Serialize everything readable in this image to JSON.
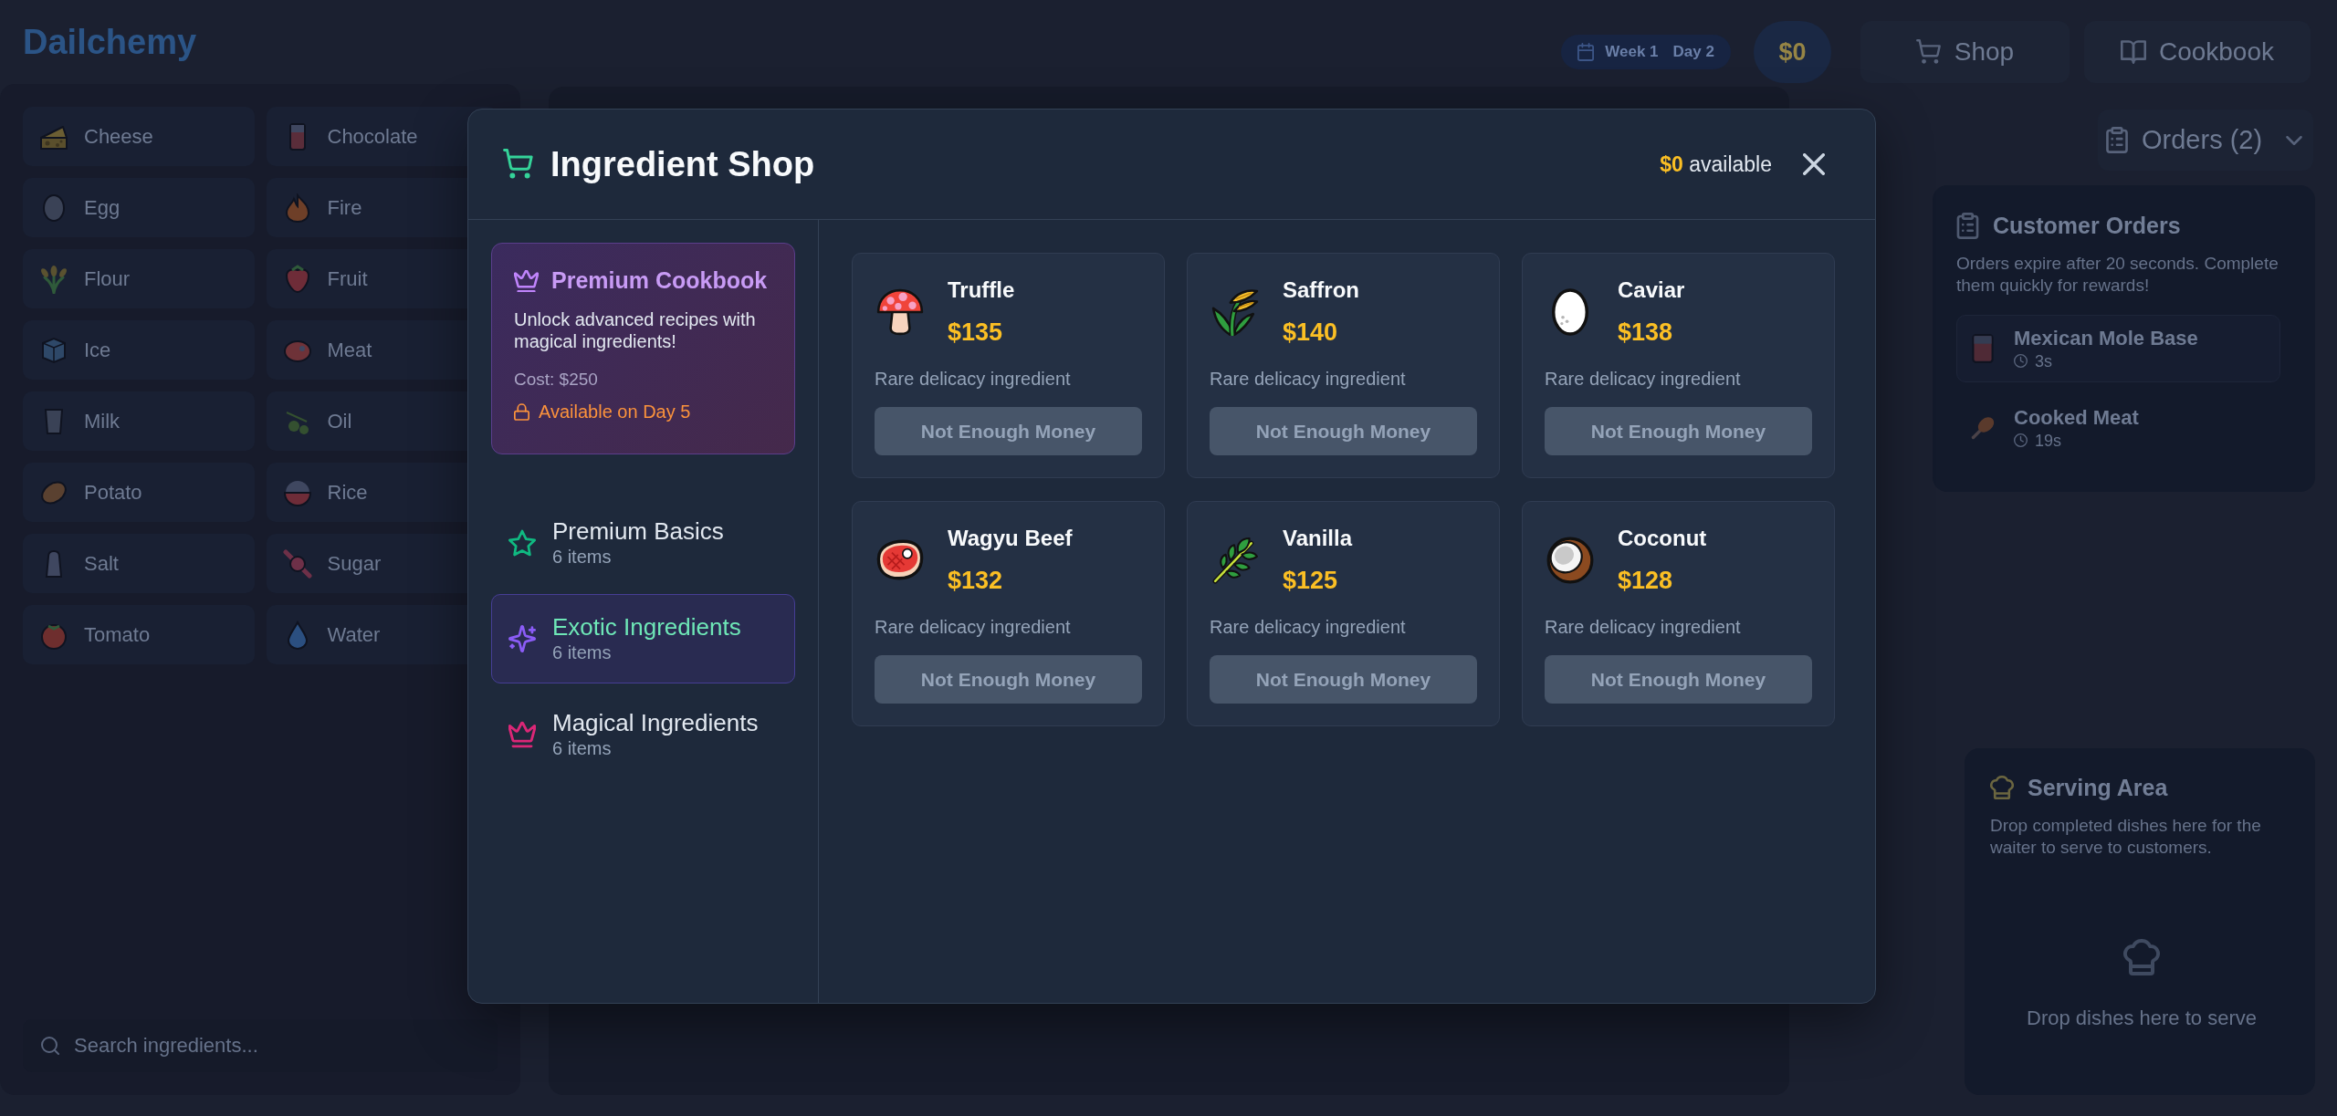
{
  "header": {
    "logo": "Dailchemy",
    "week": "Week 1",
    "day": "Day 2",
    "money": "$0",
    "nav": [
      {
        "label": "Shop"
      },
      {
        "label": "Cookbook"
      }
    ]
  },
  "ingredient_sidebar": {
    "items": [
      {
        "label": "Cheese"
      },
      {
        "label": "Chocolate"
      },
      {
        "label": "Egg"
      },
      {
        "label": "Fire"
      },
      {
        "label": "Flour"
      },
      {
        "label": "Fruit"
      },
      {
        "label": "Ice"
      },
      {
        "label": "Meat"
      },
      {
        "label": "Milk"
      },
      {
        "label": "Oil"
      },
      {
        "label": "Potato"
      },
      {
        "label": "Rice"
      },
      {
        "label": "Salt"
      },
      {
        "label": "Sugar"
      },
      {
        "label": "Tomato"
      },
      {
        "label": "Water"
      }
    ],
    "search": {
      "placeholder": "Search ingredients..."
    }
  },
  "orders_panel": {
    "toggle": "Orders (2)",
    "title": "Customer Orders",
    "description": "Orders expire after 20 seconds. Complete them quickly for rewards!",
    "orders": [
      {
        "name": "Mexican Mole Base",
        "time": "3s",
        "selected": true
      },
      {
        "name": "Cooked Meat",
        "time": "19s",
        "selected": false
      }
    ]
  },
  "serving_area": {
    "title": "Serving Area",
    "description": "Drop completed dishes here for the waiter to serve to customers.",
    "drop_hint": "Drop dishes here to serve"
  },
  "shop_modal": {
    "title": "Ingredient Shop",
    "balance": "**$0** available",
    "premium_cookbook": {
      "title": "Premium Cookbook",
      "description": "Unlock advanced recipes with magical ingredients!",
      "cost": "Cost: $250",
      "availability": "Available on Day 5"
    },
    "categories": [
      {
        "name": "Premium Basics",
        "count": "6 items",
        "selected": false
      },
      {
        "name": "Exotic Ingredients",
        "count": "6 items",
        "selected": true
      },
      {
        "name": "Magical Ingredients",
        "count": "6 items",
        "selected": false
      }
    ],
    "products": [
      {
        "name": "Truffle",
        "price": "$135",
        "description": "Rare delicacy ingredient",
        "button": "Not Enough Money",
        "disabled": true
      },
      {
        "name": "Saffron",
        "price": "$140",
        "description": "Rare delicacy ingredient",
        "button": "Not Enough Money",
        "disabled": true
      },
      {
        "name": "Caviar",
        "price": "$138",
        "description": "Rare delicacy ingredient",
        "button": "Not Enough Money",
        "disabled": true
      },
      {
        "name": "Wagyu Beef",
        "price": "$132",
        "description": "Rare delicacy ingredient",
        "button": "Not Enough Money",
        "disabled": true
      },
      {
        "name": "Vanilla",
        "price": "$125",
        "description": "Rare delicacy ingredient",
        "button": "Not Enough Money",
        "disabled": true
      },
      {
        "name": "Coconut",
        "price": "$128",
        "description": "Rare delicacy ingredient",
        "button": "Not Enough Money",
        "disabled": true
      }
    ]
  }
}
